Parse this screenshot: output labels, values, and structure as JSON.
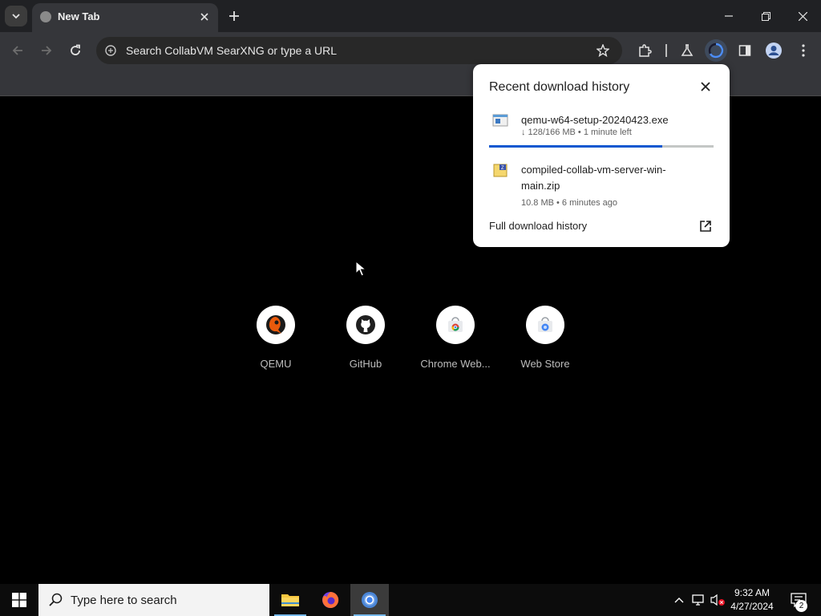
{
  "browser": {
    "tab_title": "New Tab",
    "omnibox_placeholder": "Search CollabVM SearXNG or type a URL"
  },
  "shortcuts": [
    {
      "label": "QEMU"
    },
    {
      "label": "GitHub"
    },
    {
      "label": "Chrome Web..."
    },
    {
      "label": "Web Store"
    }
  ],
  "downloads": {
    "title": "Recent download history",
    "items": [
      {
        "name": "qemu-w64-setup-20240423.exe",
        "meta": "↓ 128/166 MB • 1 minute left",
        "progress": 0.77
      },
      {
        "name": "compiled-collab-vm-server-win-main.zip",
        "meta": "10.8 MB • 6 minutes ago"
      }
    ],
    "full_history_label": "Full download history"
  },
  "taskbar": {
    "search_placeholder": "Type here to search",
    "time": "9:32 AM",
    "date": "4/27/2024",
    "notification_count": "2"
  },
  "colors": {
    "accent": "#0b57d0",
    "taskbar_highlight": "#76b9ed"
  }
}
